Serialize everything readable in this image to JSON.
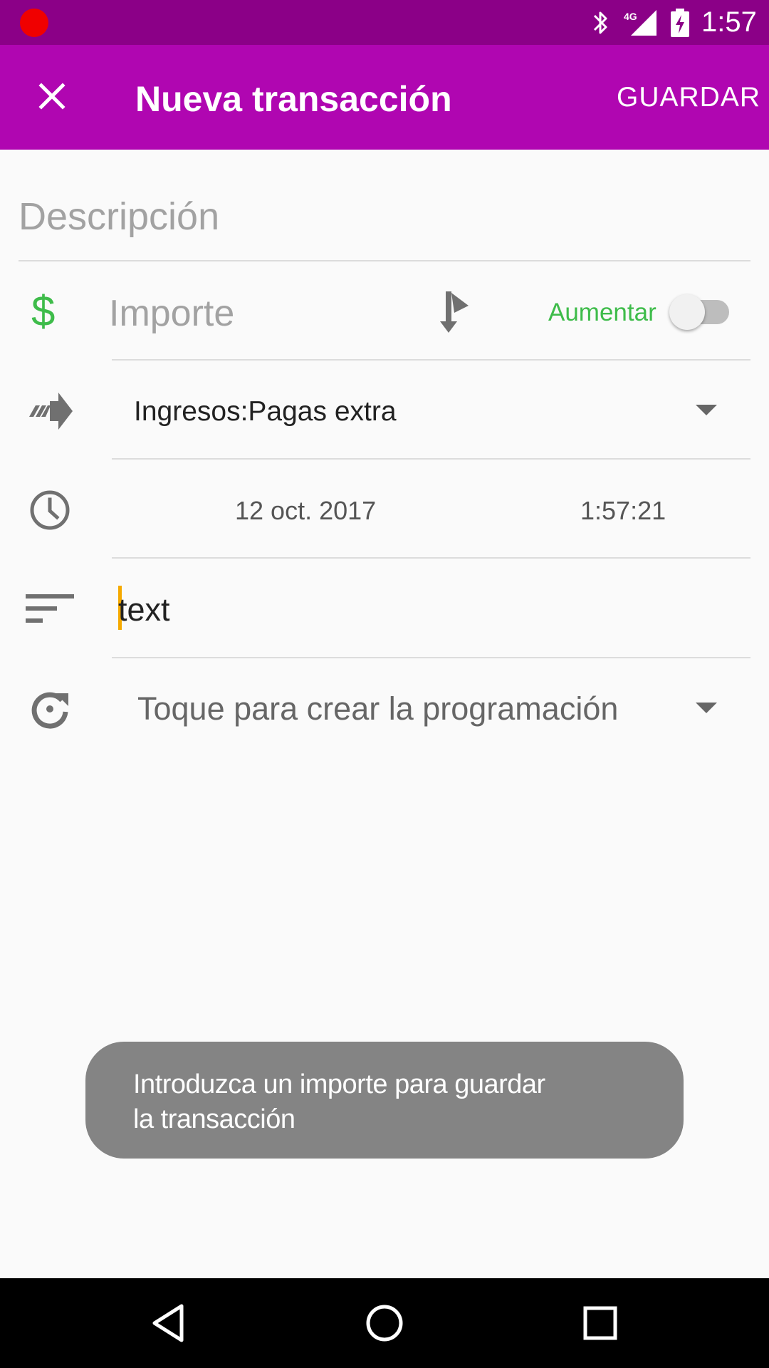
{
  "status_bar": {
    "time": "1:57",
    "network_label": "4G",
    "icons": [
      "record-indicator-icon",
      "bluetooth-icon",
      "signal-icon",
      "battery-charging-icon"
    ]
  },
  "toolbar": {
    "title": "Nueva transacción",
    "save_label": "GUARDAR",
    "close_icon": "close-icon",
    "background": "#b006b1"
  },
  "form": {
    "description_placeholder": "Descripción",
    "amount_currency": "$",
    "amount_placeholder": "Importe",
    "toggle_label": "Aumentar",
    "toggle_on": false,
    "account": "Ingresos:Pagas extra",
    "date": "12 oct. 2017",
    "time": "1:57:21",
    "notes_value": "text",
    "schedule_label": "Toque para crear la programación"
  },
  "toast": {
    "line1": "Introduzca un importe para guardar",
    "line2": "la transacción"
  },
  "nav_bar": {
    "icons": [
      "back-icon",
      "home-icon",
      "recents-icon"
    ]
  },
  "colors": {
    "status_bar": "#8b0087",
    "toolbar": "#b006b1",
    "accent_green": "#3ebc4a",
    "cursor": "#f6a900",
    "toast": "#848484"
  }
}
